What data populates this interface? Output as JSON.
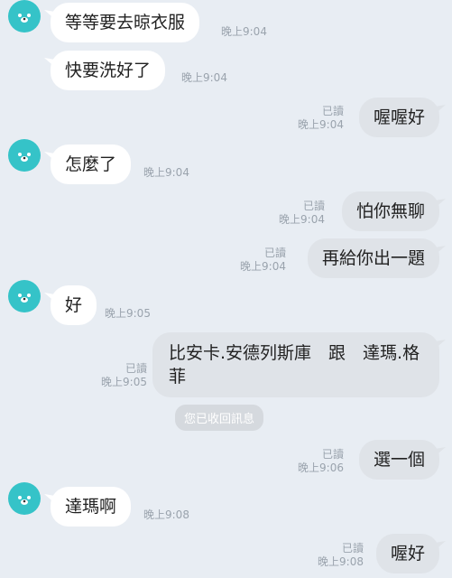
{
  "colors": {
    "background": "#e8edf3",
    "incoming_bubble": "#ffffff",
    "outgoing_bubble": "#dfe3e8",
    "avatar": "#35c3c8",
    "meta_text": "#9aa3ad"
  },
  "messages": [
    {
      "side": "in",
      "text": "等等要去晾衣服",
      "time": "晚上9:04",
      "avatar": "bear-avatar-icon"
    },
    {
      "side": "in",
      "text": "快要洗好了",
      "time": "晚上9:04"
    },
    {
      "side": "out",
      "text": "喔喔好",
      "read": "已讀",
      "time": "晚上9:04"
    },
    {
      "side": "in",
      "text": "怎麼了",
      "time": "晚上9:04",
      "avatar": "bear-avatar-icon"
    },
    {
      "side": "out",
      "text": "怕你無聊",
      "read": "已讀",
      "time": "晚上9:04"
    },
    {
      "side": "out",
      "text": "再給你出一題",
      "read": "已讀",
      "time": "晚上9:04"
    },
    {
      "side": "in",
      "text": "好",
      "time": "晚上9:05",
      "avatar": "bear-avatar-icon"
    },
    {
      "side": "out",
      "text": "比安卡.安德列斯庫　跟　達瑪.格菲",
      "read": "已讀",
      "time": "晚上9:05"
    },
    {
      "side": "out",
      "text": "選一個",
      "read": "已讀",
      "time": "晚上9:06"
    },
    {
      "side": "in",
      "text": "達瑪啊",
      "time": "晚上9:08",
      "avatar": "bear-avatar-icon"
    },
    {
      "side": "out",
      "text": "喔好",
      "read": "已讀",
      "time": "晚上9:08"
    }
  ],
  "system_notice": "您已收回訊息"
}
